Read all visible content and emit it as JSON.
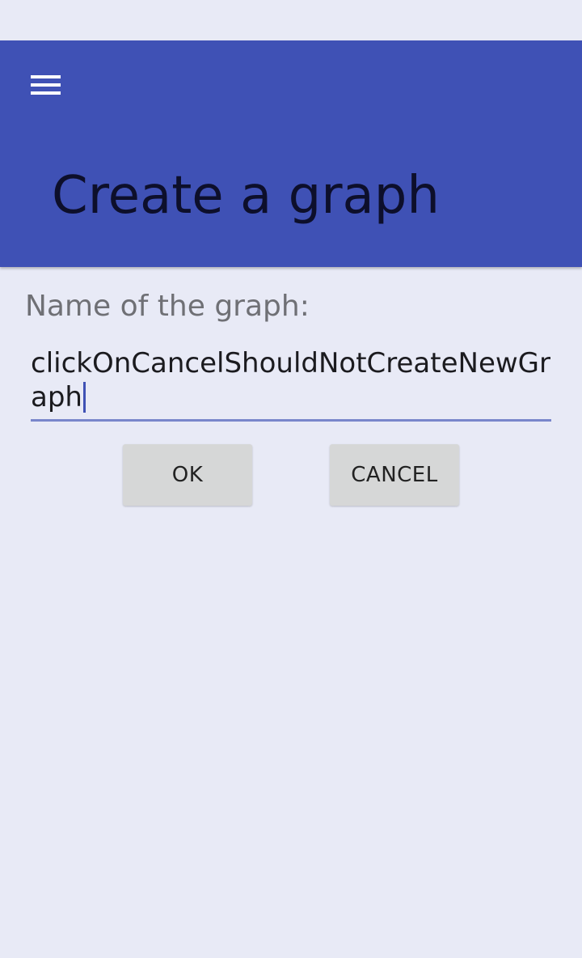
{
  "app_bar": {
    "menu_icon": "hamburger-menu-icon",
    "title": "Create a graph",
    "color": "#3f51b5"
  },
  "form": {
    "label": "Name of the graph:",
    "name_value": "clickOnCancelShouldNotCreateNewGraph",
    "ok_label": "OK",
    "cancel_label": "CANCEL"
  }
}
